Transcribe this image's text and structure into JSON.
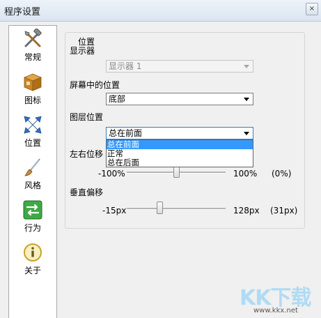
{
  "window": {
    "title": "程序设置",
    "close_label": "×"
  },
  "sidebar": {
    "items": [
      {
        "label": "常规",
        "icon": "tools-icon"
      },
      {
        "label": "图标",
        "icon": "box-icon"
      },
      {
        "label": "位置",
        "icon": "arrows-icon"
      },
      {
        "label": "风格",
        "icon": "brush-icon"
      },
      {
        "label": "行为",
        "icon": "switch-icon"
      },
      {
        "label": "关于",
        "icon": "info-icon"
      }
    ]
  },
  "position_group": {
    "title": "位置",
    "display": {
      "label": "显示器",
      "value": "显示器 1"
    },
    "screen_position": {
      "label": "屏幕中的位置",
      "value": "底部"
    },
    "layer_position": {
      "label": "图层位置",
      "value": "总在前面",
      "options": [
        "总在前面",
        "正常",
        "总在后面"
      ],
      "selected_index": 0
    },
    "horizontal_offset": {
      "label": "左右位移",
      "min_label": "-100%",
      "max_label": "100%",
      "current_label": "(0%)",
      "value_fraction": 0.5
    },
    "vertical_offset": {
      "label": "垂直偏移",
      "min_label": "-15px",
      "max_label": "128px",
      "current_label": "(31px)",
      "value_fraction": 0.32
    }
  },
  "watermark": {
    "text": "KK下载",
    "url": "www.kkx.net"
  },
  "colors": {
    "accent": "#3399ff",
    "watermark": "#9fd7f7"
  }
}
